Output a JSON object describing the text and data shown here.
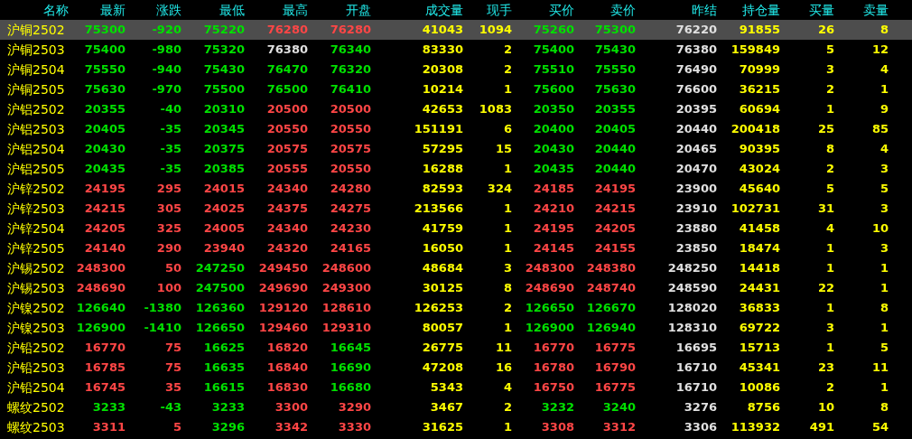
{
  "columns": [
    {
      "label": "名称",
      "kind": "name"
    },
    {
      "label": "最新",
      "kind": "price"
    },
    {
      "label": "涨跌",
      "kind": "price"
    },
    {
      "label": "最低",
      "kind": "price"
    },
    {
      "label": "最高",
      "kind": "price"
    },
    {
      "label": "开盘",
      "kind": "price"
    },
    {
      "label": "成交量",
      "kind": "volume"
    },
    {
      "label": "现手",
      "kind": "volume"
    },
    {
      "label": "买价",
      "kind": "price"
    },
    {
      "label": "卖价",
      "kind": "price"
    },
    {
      "label": "昨结",
      "kind": "settle"
    },
    {
      "label": "持仓量",
      "kind": "volume"
    },
    {
      "label": "买量",
      "kind": "volume"
    },
    {
      "label": "卖量",
      "kind": "volume"
    }
  ],
  "rows": [
    {
      "selected": true,
      "cells": [
        {
          "text": "沪铜2502"
        },
        {
          "text": "75300",
          "color": "#00e000"
        },
        {
          "text": "-920",
          "color": "#00e000"
        },
        {
          "text": "75220",
          "color": "#00e000"
        },
        {
          "text": "76280",
          "color": "#ff4646"
        },
        {
          "text": "76280",
          "color": "#ff4646"
        },
        {
          "text": "41043"
        },
        {
          "text": "1094"
        },
        {
          "text": "75260",
          "color": "#00e000"
        },
        {
          "text": "75300",
          "color": "#00e000"
        },
        {
          "text": "76220"
        },
        {
          "text": "91855"
        },
        {
          "text": "26"
        },
        {
          "text": "8"
        }
      ]
    },
    {
      "selected": false,
      "cells": [
        {
          "text": "沪铜2503"
        },
        {
          "text": "75400",
          "color": "#00e000"
        },
        {
          "text": "-980",
          "color": "#00e000"
        },
        {
          "text": "75320",
          "color": "#00e000"
        },
        {
          "text": "76380",
          "color": "#e0e0e0"
        },
        {
          "text": "76340",
          "color": "#00e000"
        },
        {
          "text": "83330"
        },
        {
          "text": "2"
        },
        {
          "text": "75400",
          "color": "#00e000"
        },
        {
          "text": "75430",
          "color": "#00e000"
        },
        {
          "text": "76380"
        },
        {
          "text": "159849"
        },
        {
          "text": "5"
        },
        {
          "text": "12"
        }
      ]
    },
    {
      "selected": false,
      "cells": [
        {
          "text": "沪铜2504"
        },
        {
          "text": "75550",
          "color": "#00e000"
        },
        {
          "text": "-940",
          "color": "#00e000"
        },
        {
          "text": "75430",
          "color": "#00e000"
        },
        {
          "text": "76470",
          "color": "#00e000"
        },
        {
          "text": "76320",
          "color": "#00e000"
        },
        {
          "text": "20308"
        },
        {
          "text": "2"
        },
        {
          "text": "75510",
          "color": "#00e000"
        },
        {
          "text": "75550",
          "color": "#00e000"
        },
        {
          "text": "76490"
        },
        {
          "text": "70999"
        },
        {
          "text": "3"
        },
        {
          "text": "4"
        }
      ]
    },
    {
      "selected": false,
      "cells": [
        {
          "text": "沪铜2505"
        },
        {
          "text": "75630",
          "color": "#00e000"
        },
        {
          "text": "-970",
          "color": "#00e000"
        },
        {
          "text": "75500",
          "color": "#00e000"
        },
        {
          "text": "76500",
          "color": "#00e000"
        },
        {
          "text": "76410",
          "color": "#00e000"
        },
        {
          "text": "10214"
        },
        {
          "text": "1"
        },
        {
          "text": "75600",
          "color": "#00e000"
        },
        {
          "text": "75630",
          "color": "#00e000"
        },
        {
          "text": "76600"
        },
        {
          "text": "36215"
        },
        {
          "text": "2"
        },
        {
          "text": "1"
        }
      ]
    },
    {
      "selected": false,
      "cells": [
        {
          "text": "沪铝2502"
        },
        {
          "text": "20355",
          "color": "#00e000"
        },
        {
          "text": "-40",
          "color": "#00e000"
        },
        {
          "text": "20310",
          "color": "#00e000"
        },
        {
          "text": "20500",
          "color": "#ff4646"
        },
        {
          "text": "20500",
          "color": "#ff4646"
        },
        {
          "text": "42653"
        },
        {
          "text": "1083"
        },
        {
          "text": "20350",
          "color": "#00e000"
        },
        {
          "text": "20355",
          "color": "#00e000"
        },
        {
          "text": "20395"
        },
        {
          "text": "60694"
        },
        {
          "text": "1"
        },
        {
          "text": "9"
        }
      ]
    },
    {
      "selected": false,
      "cells": [
        {
          "text": "沪铝2503"
        },
        {
          "text": "20405",
          "color": "#00e000"
        },
        {
          "text": "-35",
          "color": "#00e000"
        },
        {
          "text": "20345",
          "color": "#00e000"
        },
        {
          "text": "20550",
          "color": "#ff4646"
        },
        {
          "text": "20550",
          "color": "#ff4646"
        },
        {
          "text": "151191"
        },
        {
          "text": "6"
        },
        {
          "text": "20400",
          "color": "#00e000"
        },
        {
          "text": "20405",
          "color": "#00e000"
        },
        {
          "text": "20440"
        },
        {
          "text": "200418"
        },
        {
          "text": "25"
        },
        {
          "text": "85"
        }
      ]
    },
    {
      "selected": false,
      "cells": [
        {
          "text": "沪铝2504"
        },
        {
          "text": "20430",
          "color": "#00e000"
        },
        {
          "text": "-35",
          "color": "#00e000"
        },
        {
          "text": "20375",
          "color": "#00e000"
        },
        {
          "text": "20575",
          "color": "#ff4646"
        },
        {
          "text": "20575",
          "color": "#ff4646"
        },
        {
          "text": "57295"
        },
        {
          "text": "15"
        },
        {
          "text": "20430",
          "color": "#00e000"
        },
        {
          "text": "20440",
          "color": "#00e000"
        },
        {
          "text": "20465"
        },
        {
          "text": "90395"
        },
        {
          "text": "8"
        },
        {
          "text": "4"
        }
      ]
    },
    {
      "selected": false,
      "cells": [
        {
          "text": "沪铝2505"
        },
        {
          "text": "20435",
          "color": "#00e000"
        },
        {
          "text": "-35",
          "color": "#00e000"
        },
        {
          "text": "20385",
          "color": "#00e000"
        },
        {
          "text": "20555",
          "color": "#ff4646"
        },
        {
          "text": "20550",
          "color": "#ff4646"
        },
        {
          "text": "16288"
        },
        {
          "text": "1"
        },
        {
          "text": "20435",
          "color": "#00e000"
        },
        {
          "text": "20440",
          "color": "#00e000"
        },
        {
          "text": "20470"
        },
        {
          "text": "43024"
        },
        {
          "text": "2"
        },
        {
          "text": "3"
        }
      ]
    },
    {
      "selected": false,
      "cells": [
        {
          "text": "沪锌2502"
        },
        {
          "text": "24195",
          "color": "#ff4646"
        },
        {
          "text": "295",
          "color": "#ff4646"
        },
        {
          "text": "24015",
          "color": "#ff4646"
        },
        {
          "text": "24340",
          "color": "#ff4646"
        },
        {
          "text": "24280",
          "color": "#ff4646"
        },
        {
          "text": "82593"
        },
        {
          "text": "324"
        },
        {
          "text": "24185",
          "color": "#ff4646"
        },
        {
          "text": "24195",
          "color": "#ff4646"
        },
        {
          "text": "23900"
        },
        {
          "text": "45640"
        },
        {
          "text": "5"
        },
        {
          "text": "5"
        }
      ]
    },
    {
      "selected": false,
      "cells": [
        {
          "text": "沪锌2503"
        },
        {
          "text": "24215",
          "color": "#ff4646"
        },
        {
          "text": "305",
          "color": "#ff4646"
        },
        {
          "text": "24025",
          "color": "#ff4646"
        },
        {
          "text": "24375",
          "color": "#ff4646"
        },
        {
          "text": "24275",
          "color": "#ff4646"
        },
        {
          "text": "213566"
        },
        {
          "text": "1"
        },
        {
          "text": "24210",
          "color": "#ff4646"
        },
        {
          "text": "24215",
          "color": "#ff4646"
        },
        {
          "text": "23910"
        },
        {
          "text": "102731"
        },
        {
          "text": "31"
        },
        {
          "text": "3"
        }
      ]
    },
    {
      "selected": false,
      "cells": [
        {
          "text": "沪锌2504"
        },
        {
          "text": "24205",
          "color": "#ff4646"
        },
        {
          "text": "325",
          "color": "#ff4646"
        },
        {
          "text": "24005",
          "color": "#ff4646"
        },
        {
          "text": "24340",
          "color": "#ff4646"
        },
        {
          "text": "24230",
          "color": "#ff4646"
        },
        {
          "text": "41759"
        },
        {
          "text": "1"
        },
        {
          "text": "24195",
          "color": "#ff4646"
        },
        {
          "text": "24205",
          "color": "#ff4646"
        },
        {
          "text": "23880"
        },
        {
          "text": "41458"
        },
        {
          "text": "4"
        },
        {
          "text": "10"
        }
      ]
    },
    {
      "selected": false,
      "cells": [
        {
          "text": "沪锌2505"
        },
        {
          "text": "24140",
          "color": "#ff4646"
        },
        {
          "text": "290",
          "color": "#ff4646"
        },
        {
          "text": "23940",
          "color": "#ff4646"
        },
        {
          "text": "24320",
          "color": "#ff4646"
        },
        {
          "text": "24165",
          "color": "#ff4646"
        },
        {
          "text": "16050"
        },
        {
          "text": "1"
        },
        {
          "text": "24145",
          "color": "#ff4646"
        },
        {
          "text": "24155",
          "color": "#ff4646"
        },
        {
          "text": "23850"
        },
        {
          "text": "18474"
        },
        {
          "text": "1"
        },
        {
          "text": "3"
        }
      ]
    },
    {
      "selected": false,
      "cells": [
        {
          "text": "沪锡2502"
        },
        {
          "text": "248300",
          "color": "#ff4646"
        },
        {
          "text": "50",
          "color": "#ff4646"
        },
        {
          "text": "247250",
          "color": "#00e000"
        },
        {
          "text": "249450",
          "color": "#ff4646"
        },
        {
          "text": "248600",
          "color": "#ff4646"
        },
        {
          "text": "48684"
        },
        {
          "text": "3"
        },
        {
          "text": "248300",
          "color": "#ff4646"
        },
        {
          "text": "248380",
          "color": "#ff4646"
        },
        {
          "text": "248250"
        },
        {
          "text": "14418"
        },
        {
          "text": "1"
        },
        {
          "text": "1"
        }
      ]
    },
    {
      "selected": false,
      "cells": [
        {
          "text": "沪锡2503"
        },
        {
          "text": "248690",
          "color": "#ff4646"
        },
        {
          "text": "100",
          "color": "#ff4646"
        },
        {
          "text": "247500",
          "color": "#00e000"
        },
        {
          "text": "249690",
          "color": "#ff4646"
        },
        {
          "text": "249300",
          "color": "#ff4646"
        },
        {
          "text": "30125"
        },
        {
          "text": "8"
        },
        {
          "text": "248690",
          "color": "#ff4646"
        },
        {
          "text": "248740",
          "color": "#ff4646"
        },
        {
          "text": "248590"
        },
        {
          "text": "24431"
        },
        {
          "text": "22"
        },
        {
          "text": "1"
        }
      ]
    },
    {
      "selected": false,
      "cells": [
        {
          "text": "沪镍2502"
        },
        {
          "text": "126640",
          "color": "#00e000"
        },
        {
          "text": "-1380",
          "color": "#00e000"
        },
        {
          "text": "126360",
          "color": "#00e000"
        },
        {
          "text": "129120",
          "color": "#ff4646"
        },
        {
          "text": "128610",
          "color": "#ff4646"
        },
        {
          "text": "126253"
        },
        {
          "text": "2"
        },
        {
          "text": "126650",
          "color": "#00e000"
        },
        {
          "text": "126670",
          "color": "#00e000"
        },
        {
          "text": "128020"
        },
        {
          "text": "36833"
        },
        {
          "text": "1"
        },
        {
          "text": "8"
        }
      ]
    },
    {
      "selected": false,
      "cells": [
        {
          "text": "沪镍2503"
        },
        {
          "text": "126900",
          "color": "#00e000"
        },
        {
          "text": "-1410",
          "color": "#00e000"
        },
        {
          "text": "126650",
          "color": "#00e000"
        },
        {
          "text": "129460",
          "color": "#ff4646"
        },
        {
          "text": "129310",
          "color": "#ff4646"
        },
        {
          "text": "80057"
        },
        {
          "text": "1"
        },
        {
          "text": "126900",
          "color": "#00e000"
        },
        {
          "text": "126940",
          "color": "#00e000"
        },
        {
          "text": "128310"
        },
        {
          "text": "69722"
        },
        {
          "text": "3"
        },
        {
          "text": "1"
        }
      ]
    },
    {
      "selected": false,
      "cells": [
        {
          "text": "沪铅2502"
        },
        {
          "text": "16770",
          "color": "#ff4646"
        },
        {
          "text": "75",
          "color": "#ff4646"
        },
        {
          "text": "16625",
          "color": "#00e000"
        },
        {
          "text": "16820",
          "color": "#ff4646"
        },
        {
          "text": "16645",
          "color": "#00e000"
        },
        {
          "text": "26775"
        },
        {
          "text": "11"
        },
        {
          "text": "16770",
          "color": "#ff4646"
        },
        {
          "text": "16775",
          "color": "#ff4646"
        },
        {
          "text": "16695"
        },
        {
          "text": "15713"
        },
        {
          "text": "1"
        },
        {
          "text": "5"
        }
      ]
    },
    {
      "selected": false,
      "cells": [
        {
          "text": "沪铅2503"
        },
        {
          "text": "16785",
          "color": "#ff4646"
        },
        {
          "text": "75",
          "color": "#ff4646"
        },
        {
          "text": "16635",
          "color": "#00e000"
        },
        {
          "text": "16840",
          "color": "#ff4646"
        },
        {
          "text": "16690",
          "color": "#00e000"
        },
        {
          "text": "47208"
        },
        {
          "text": "16"
        },
        {
          "text": "16780",
          "color": "#ff4646"
        },
        {
          "text": "16790",
          "color": "#ff4646"
        },
        {
          "text": "16710"
        },
        {
          "text": "45341"
        },
        {
          "text": "23"
        },
        {
          "text": "11"
        }
      ]
    },
    {
      "selected": false,
      "cells": [
        {
          "text": "沪铅2504"
        },
        {
          "text": "16745",
          "color": "#ff4646"
        },
        {
          "text": "35",
          "color": "#ff4646"
        },
        {
          "text": "16615",
          "color": "#00e000"
        },
        {
          "text": "16830",
          "color": "#ff4646"
        },
        {
          "text": "16680",
          "color": "#00e000"
        },
        {
          "text": "5343"
        },
        {
          "text": "4"
        },
        {
          "text": "16750",
          "color": "#ff4646"
        },
        {
          "text": "16775",
          "color": "#ff4646"
        },
        {
          "text": "16710"
        },
        {
          "text": "10086"
        },
        {
          "text": "2"
        },
        {
          "text": "1"
        }
      ]
    },
    {
      "selected": false,
      "cells": [
        {
          "text": "螺纹2502"
        },
        {
          "text": "3233",
          "color": "#00e000"
        },
        {
          "text": "-43",
          "color": "#00e000"
        },
        {
          "text": "3233",
          "color": "#00e000"
        },
        {
          "text": "3300",
          "color": "#ff4646"
        },
        {
          "text": "3290",
          "color": "#ff4646"
        },
        {
          "text": "3467"
        },
        {
          "text": "2"
        },
        {
          "text": "3232",
          "color": "#00e000"
        },
        {
          "text": "3240",
          "color": "#00e000"
        },
        {
          "text": "3276"
        },
        {
          "text": "8756"
        },
        {
          "text": "10"
        },
        {
          "text": "8"
        }
      ]
    },
    {
      "selected": false,
      "cells": [
        {
          "text": "螺纹2503"
        },
        {
          "text": "3311",
          "color": "#ff4646"
        },
        {
          "text": "5",
          "color": "#ff4646"
        },
        {
          "text": "3296",
          "color": "#00e000"
        },
        {
          "text": "3342",
          "color": "#ff4646"
        },
        {
          "text": "3330",
          "color": "#ff4646"
        },
        {
          "text": "31625"
        },
        {
          "text": "1"
        },
        {
          "text": "3308",
          "color": "#ff4646"
        },
        {
          "text": "3312",
          "color": "#ff4646"
        },
        {
          "text": "3306"
        },
        {
          "text": "113932"
        },
        {
          "text": "491"
        },
        {
          "text": "54"
        }
      ]
    }
  ]
}
